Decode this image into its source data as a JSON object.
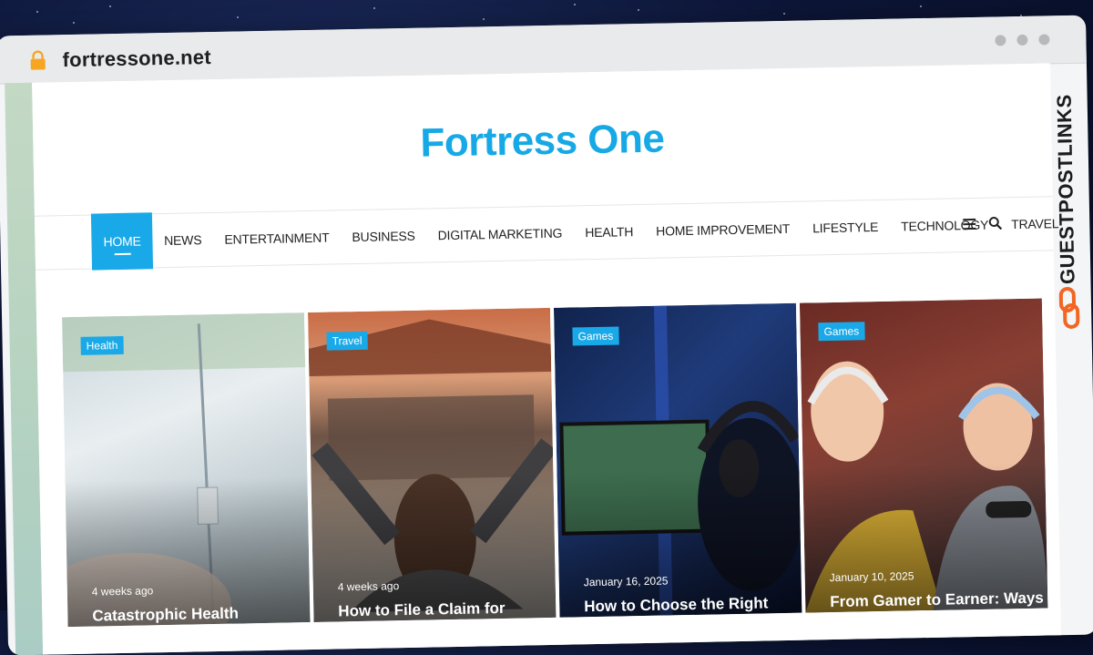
{
  "browser": {
    "url": "fortressone.net",
    "lock_icon": "lock-icon",
    "accent": "#f6a623"
  },
  "site": {
    "title": "Fortress One",
    "title_color": "#16a9e6"
  },
  "nav": {
    "items": [
      {
        "label": "HOME",
        "active": true
      },
      {
        "label": "NEWS"
      },
      {
        "label": "ENTERTAINMENT"
      },
      {
        "label": "BUSINESS"
      },
      {
        "label": "DIGITAL MARKETING"
      },
      {
        "label": "HEALTH"
      },
      {
        "label": "HOME IMPROVEMENT"
      },
      {
        "label": "LIFESTYLE"
      },
      {
        "label": "TECHNOLOGY"
      },
      {
        "label": "TRAVEL"
      }
    ],
    "icons": [
      "menu-icon",
      "search-icon"
    ],
    "active_color": "#1aa9e8"
  },
  "cards": [
    {
      "tag": "Health",
      "date": "4 weeks ago",
      "title": "Catastrophic Health Insurance"
    },
    {
      "tag": "Travel",
      "date": "4 weeks ago",
      "title": "How to File a Claim for"
    },
    {
      "tag": "Games",
      "date": "January 16, 2025",
      "title": "How to Choose the Right"
    },
    {
      "tag": "Games",
      "date": "January 10, 2025",
      "title": "From Gamer to Earner: Ways to Monetize Your Online"
    }
  ],
  "side_banner": {
    "text": "GUESTPOSTLINKS",
    "icon": "link-icon",
    "icon_color": "#f26522"
  }
}
